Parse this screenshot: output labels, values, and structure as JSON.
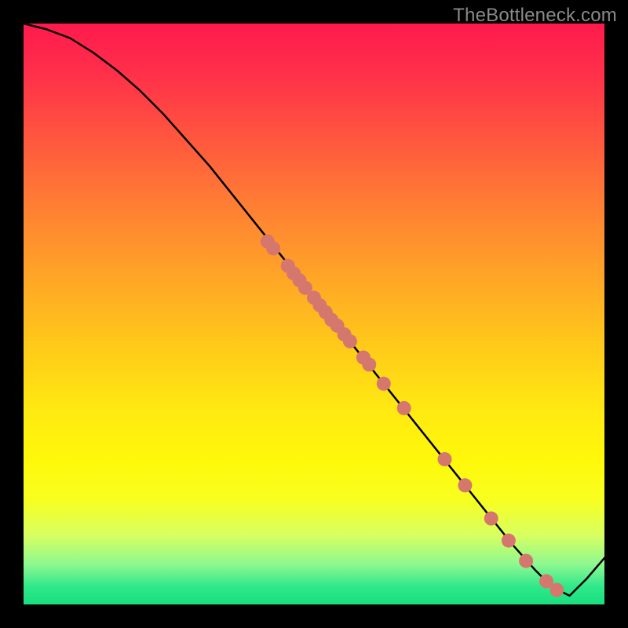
{
  "watermark": "TheBottleneck.com",
  "chart_data": {
    "type": "line",
    "title": "",
    "xlabel": "",
    "ylabel": "",
    "xlim": [
      0,
      100
    ],
    "ylim": [
      0,
      100
    ],
    "series": [
      {
        "name": "curve",
        "x": [
          0,
          4,
          8,
          12,
          16,
          20,
          24,
          28,
          32,
          36,
          40,
          44,
          48,
          52,
          56,
          60,
          64,
          68,
          72,
          76,
          80,
          84,
          88,
          91,
          94,
          97,
          100
        ],
        "y": [
          100,
          99,
          97.5,
          95,
          92,
          88.5,
          84.5,
          80,
          75.5,
          70.5,
          65.5,
          60.5,
          55.5,
          50.5,
          45.5,
          40.5,
          35.5,
          30.5,
          25.5,
          20.5,
          15.5,
          10.5,
          6,
          3,
          1.5,
          4.5,
          8
        ]
      }
    ],
    "markers": {
      "name": "dots",
      "color": "#d6776e",
      "radius": 9,
      "points": [
        {
          "x": 42,
          "y": 62.5
        },
        {
          "x": 43,
          "y": 61.3
        },
        {
          "x": 45.5,
          "y": 58.3
        },
        {
          "x": 46.5,
          "y": 57
        },
        {
          "x": 47.5,
          "y": 55.8
        },
        {
          "x": 48.5,
          "y": 54.5
        },
        {
          "x": 50,
          "y": 52.8
        },
        {
          "x": 51,
          "y": 51.5
        },
        {
          "x": 52,
          "y": 50.3
        },
        {
          "x": 53,
          "y": 49
        },
        {
          "x": 54,
          "y": 48
        },
        {
          "x": 55.2,
          "y": 46.5
        },
        {
          "x": 56.2,
          "y": 45.3
        },
        {
          "x": 58.5,
          "y": 42.5
        },
        {
          "x": 59.5,
          "y": 41.3
        },
        {
          "x": 62,
          "y": 38
        },
        {
          "x": 65.5,
          "y": 33.8
        },
        {
          "x": 72.5,
          "y": 25
        },
        {
          "x": 76,
          "y": 20.5
        },
        {
          "x": 80.5,
          "y": 14.8
        },
        {
          "x": 83.5,
          "y": 11
        },
        {
          "x": 86.5,
          "y": 7.5
        },
        {
          "x": 90,
          "y": 4
        },
        {
          "x": 91.8,
          "y": 2.5
        }
      ]
    }
  }
}
